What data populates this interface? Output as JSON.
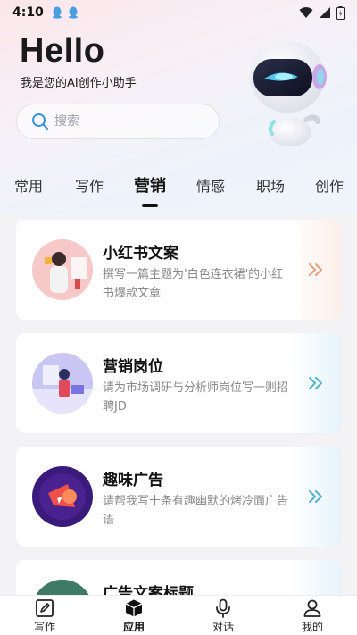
{
  "status_bar": {
    "time": "4:10",
    "left_icons": [
      "qq-penguin-icon",
      "qq-penguin-icon"
    ],
    "right_icons": [
      "wifi-icon",
      "signal-icon",
      "battery-icon"
    ]
  },
  "header": {
    "greeting": "Hello",
    "subtitle": "我是您的AI创作小助手",
    "search": {
      "placeholder": "搜索",
      "value": ""
    }
  },
  "tabs": [
    {
      "label": "常用",
      "active": false
    },
    {
      "label": "写作",
      "active": false
    },
    {
      "label": "营销",
      "active": true
    },
    {
      "label": "情感",
      "active": false
    },
    {
      "label": "职场",
      "active": false
    },
    {
      "label": "创作",
      "active": false
    }
  ],
  "cards": [
    {
      "title": "小红书文案",
      "description": "撰写一篇主题为'白色连衣裙'的小红书爆款文章",
      "arrow_color": "#f19a7c",
      "arrow_bg": "#fdeee8"
    },
    {
      "title": "营销岗位",
      "description": "请为市场调研与分析师岗位写一则招聘JD",
      "arrow_color": "#4fb2d6",
      "arrow_bg": "#e6f4fa"
    },
    {
      "title": "趣味广告",
      "description": "请帮我写十条有趣幽默的烤冷面广告语",
      "arrow_color": "#4fb2d6",
      "arrow_bg": "#e6f4fa"
    },
    {
      "title": "广告文案标题",
      "description": "",
      "arrow_color": "#4fb2d6",
      "arrow_bg": "#e6f4fa"
    }
  ],
  "bottom_nav": [
    {
      "label": "写作",
      "icon": "edit-document-icon",
      "active": false
    },
    {
      "label": "应用",
      "icon": "cube-icon",
      "active": true
    },
    {
      "label": "对话",
      "icon": "microphone-icon",
      "active": false
    },
    {
      "label": "我的",
      "icon": "user-icon",
      "active": false
    }
  ],
  "colors": {
    "accent": "#111111",
    "search_icon": "#3a8ee6"
  }
}
